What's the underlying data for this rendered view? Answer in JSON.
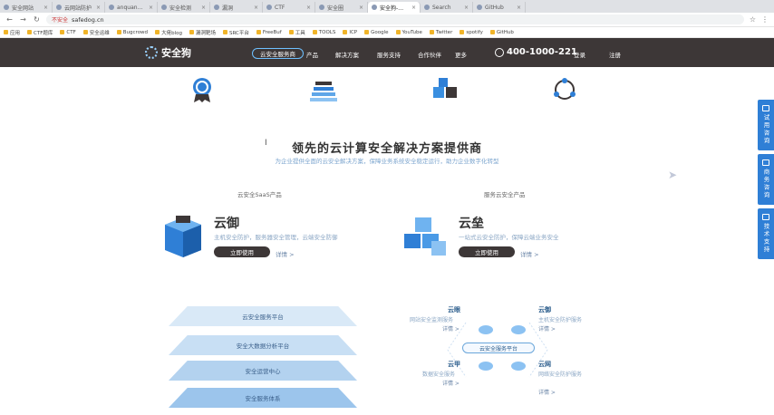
{
  "browser": {
    "tabs": [
      {
        "label": "安全网站",
        "active": false
      },
      {
        "label": "云网站防护",
        "active": false
      },
      {
        "label": "anquanbao.com",
        "active": false
      },
      {
        "label": "安全检测",
        "active": false
      },
      {
        "label": "漏洞",
        "active": false
      },
      {
        "label": "CTF",
        "active": false
      },
      {
        "label": "安全圈",
        "active": false
      },
      {
        "label": "安全狗-云安全服务",
        "active": true
      },
      {
        "label": "Search",
        "active": false
      },
      {
        "label": "GitHub",
        "active": false
      }
    ],
    "url_warning": "不安全",
    "url": "safedog.cn",
    "bookmarks": [
      "应用",
      "CTF题库",
      "CTF",
      "安全运维",
      "Bugcrowd",
      "大佬blog",
      "漏洞靶场",
      "SRC平台",
      "FreeBuf",
      "工具",
      "TOOLS",
      "ICP",
      "Google",
      "YouTube",
      "Twitter",
      "spotify",
      "GitHub"
    ]
  },
  "site": {
    "logo": "安全狗",
    "pill": "云安全服务商",
    "nav": [
      "产品",
      "解决方案",
      "服务支持",
      "合作伙伴",
      "更多"
    ],
    "phone": "400-1000-221",
    "login": "登录",
    "register": "注册"
  },
  "section": {
    "title": "领先的云计算安全解决方案提供商",
    "subtitle": "为企业提供全面的云安全解决方案，保障业务系统安全稳定运行，助力企业数字化转型"
  },
  "left_col": {
    "tag": "云安全SaaS产品",
    "name": "云御",
    "desc": "主机安全防护，服务器安全管理，云端安全防御",
    "button": "立即使用",
    "more": "详情 >"
  },
  "right_col": {
    "tag": "服务云安全产品",
    "name": "云垒",
    "desc": "一站式云安全防护，保障云端业务安全",
    "button": "立即使用",
    "more": "详情 >"
  },
  "layers": [
    "云安全服务平台",
    "安全大数据分析平台",
    "安全运营中心",
    "安全服务体系"
  ],
  "diagram": {
    "hub": "云安全服务平台",
    "nodes": [
      {
        "title": "云眼",
        "desc": "网站安全监测服务",
        "link": "详情 >"
      },
      {
        "title": "云御",
        "desc": "主机安全防护服务",
        "link": "详情 >"
      },
      {
        "title": "云甲",
        "desc": "数据安全服务",
        "link": "详情 >"
      },
      {
        "title": "云网",
        "desc": "网络安全防护服务",
        "link": "详情 >"
      }
    ]
  },
  "floats": [
    "试用咨询",
    "商务咨询",
    "技术支持"
  ],
  "colors": {
    "nav_bg": "#3d3737",
    "accent": "#2f7fd6",
    "layer": "#a9ccec"
  }
}
